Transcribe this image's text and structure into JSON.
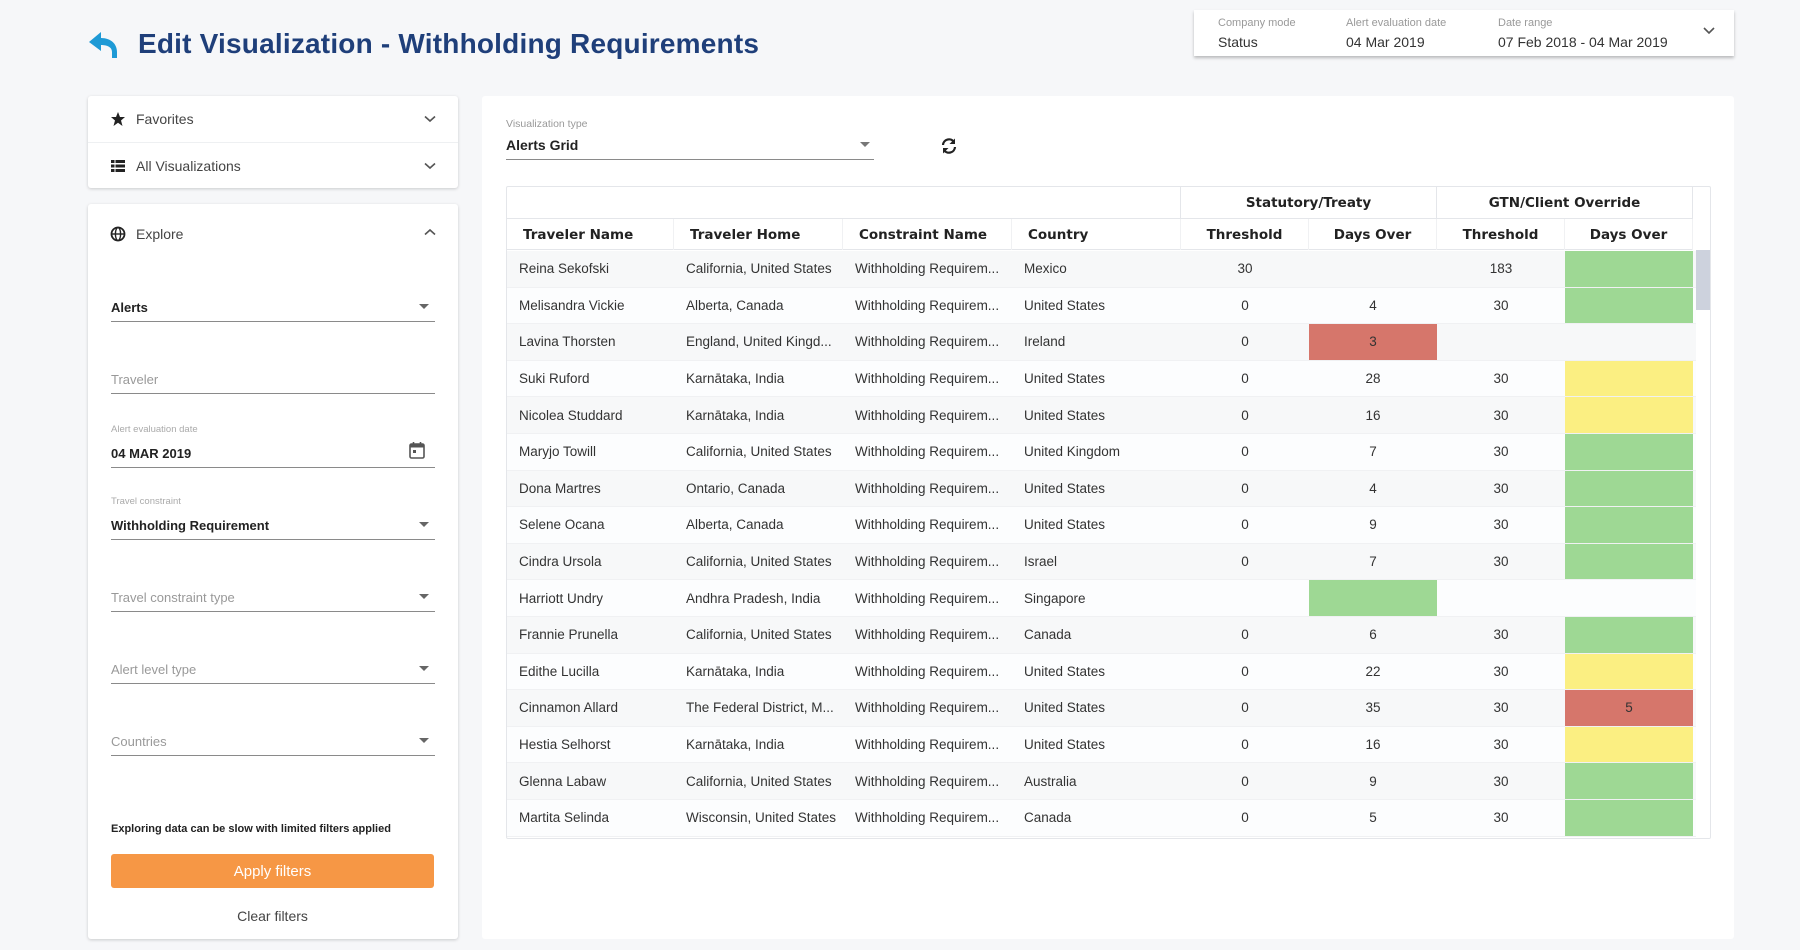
{
  "header": {
    "title": "Edit Visualization - Withholding Requirements",
    "back_icon": "reply-arrow-icon",
    "accent_color": "#1f3f7a"
  },
  "context_bar": {
    "company_mode_label": "Company mode",
    "company_mode_value": "Status",
    "alert_date_label": "Alert evaluation date",
    "alert_date_value": "04 Mar 2019",
    "date_range_label": "Date range",
    "date_range_value": "07 Feb 2018 - 04 Mar 2019"
  },
  "nav": {
    "items": [
      {
        "label": "Favorites",
        "icon": "star-icon"
      },
      {
        "label": "All Visualizations",
        "icon": "list-icon"
      }
    ]
  },
  "explore": {
    "title": "Explore",
    "icon": "globe-icon",
    "fields": {
      "data_source": {
        "value": "Alerts"
      },
      "traveler": {
        "placeholder": "Traveler"
      },
      "alert_date": {
        "label": "Alert evaluation date",
        "value": "04 MAR 2019"
      },
      "travel_constraint": {
        "label": "Travel constraint",
        "value": "Withholding Requirement"
      },
      "travel_constraint_type": {
        "placeholder": "Travel constraint type"
      },
      "alert_level_type": {
        "placeholder": "Alert level type"
      },
      "countries": {
        "placeholder": "Countries"
      }
    },
    "warning": "Exploring data can be slow with limited filters applied",
    "apply_label": "Apply filters",
    "clear_label": "Clear filters",
    "apply_color": "#f69745"
  },
  "main": {
    "vis_type_label": "Visualization type",
    "vis_type_value": "Alerts Grid",
    "refresh_icon": "refresh-icon"
  },
  "grid": {
    "groups": {
      "statutory": "Statutory/Treaty",
      "override": "GTN/Client Override"
    },
    "columns": [
      "Traveler Name",
      "Traveler Home",
      "Constraint Name",
      "Country",
      "Threshold",
      "Days Over",
      "Threshold",
      "Days Over"
    ],
    "status_colors": {
      "green": "#9ed894",
      "yellow": "#fbef82",
      "red": "#d6766b"
    },
    "rows": [
      {
        "name": "Reina Sekofski",
        "home": "California, United States",
        "constraint": "Withholding Requirem...",
        "country": "Mexico",
        "st_threshold": "30",
        "st_days": "",
        "st_status": "",
        "ov_threshold": "183",
        "ov_days": "",
        "ov_status": "green"
      },
      {
        "name": "Melisandra Vickie",
        "home": "Alberta, Canada",
        "constraint": "Withholding Requirem...",
        "country": "United States",
        "st_threshold": "0",
        "st_days": "4",
        "st_status": "",
        "ov_threshold": "30",
        "ov_days": "",
        "ov_status": "green"
      },
      {
        "name": "Lavina Thorsten",
        "home": "England, United Kingd...",
        "constraint": "Withholding Requirem...",
        "country": "Ireland",
        "st_threshold": "0",
        "st_days": "3",
        "st_status": "red",
        "ov_threshold": "",
        "ov_days": "",
        "ov_status": ""
      },
      {
        "name": "Suki Ruford",
        "home": "Karnātaka, India",
        "constraint": "Withholding Requirem...",
        "country": "United States",
        "st_threshold": "0",
        "st_days": "28",
        "st_status": "",
        "ov_threshold": "30",
        "ov_days": "",
        "ov_status": "yellow"
      },
      {
        "name": "Nicolea Studdard",
        "home": "Karnātaka, India",
        "constraint": "Withholding Requirem...",
        "country": "United States",
        "st_threshold": "0",
        "st_days": "16",
        "st_status": "",
        "ov_threshold": "30",
        "ov_days": "",
        "ov_status": "yellow"
      },
      {
        "name": "Maryjo Towill",
        "home": "California, United States",
        "constraint": "Withholding Requirem...",
        "country": "United Kingdom",
        "st_threshold": "0",
        "st_days": "7",
        "st_status": "",
        "ov_threshold": "30",
        "ov_days": "",
        "ov_status": "green"
      },
      {
        "name": "Dona Martres",
        "home": "Ontario, Canada",
        "constraint": "Withholding Requirem...",
        "country": "United States",
        "st_threshold": "0",
        "st_days": "4",
        "st_status": "",
        "ov_threshold": "30",
        "ov_days": "",
        "ov_status": "green"
      },
      {
        "name": "Selene Ocana",
        "home": "Alberta, Canada",
        "constraint": "Withholding Requirem...",
        "country": "United States",
        "st_threshold": "0",
        "st_days": "9",
        "st_status": "",
        "ov_threshold": "30",
        "ov_days": "",
        "ov_status": "green"
      },
      {
        "name": "Cindra Ursola",
        "home": "California, United States",
        "constraint": "Withholding Requirem...",
        "country": "Israel",
        "st_threshold": "0",
        "st_days": "7",
        "st_status": "",
        "ov_threshold": "30",
        "ov_days": "",
        "ov_status": "green"
      },
      {
        "name": "Harriott Undry",
        "home": "Andhra Pradesh, India",
        "constraint": "Withholding Requirem...",
        "country": "Singapore",
        "st_threshold": "",
        "st_days": "",
        "st_status": "green",
        "ov_threshold": "",
        "ov_days": "",
        "ov_status": ""
      },
      {
        "name": "Frannie Prunella",
        "home": "California, United States",
        "constraint": "Withholding Requirem...",
        "country": "Canada",
        "st_threshold": "0",
        "st_days": "6",
        "st_status": "",
        "ov_threshold": "30",
        "ov_days": "",
        "ov_status": "green"
      },
      {
        "name": "Edithe Lucilla",
        "home": "Karnātaka, India",
        "constraint": "Withholding Requirem...",
        "country": "United States",
        "st_threshold": "0",
        "st_days": "22",
        "st_status": "",
        "ov_threshold": "30",
        "ov_days": "",
        "ov_status": "yellow"
      },
      {
        "name": "Cinnamon Allard",
        "home": "The Federal District, M...",
        "constraint": "Withholding Requirem...",
        "country": "United States",
        "st_threshold": "0",
        "st_days": "35",
        "st_status": "",
        "ov_threshold": "30",
        "ov_days": "5",
        "ov_status": "red"
      },
      {
        "name": "Hestia Selhorst",
        "home": "Karnātaka, India",
        "constraint": "Withholding Requirem...",
        "country": "United States",
        "st_threshold": "0",
        "st_days": "16",
        "st_status": "",
        "ov_threshold": "30",
        "ov_days": "",
        "ov_status": "yellow"
      },
      {
        "name": "Glenna Labaw",
        "home": "California, United States",
        "constraint": "Withholding Requirem...",
        "country": "Australia",
        "st_threshold": "0",
        "st_days": "9",
        "st_status": "",
        "ov_threshold": "30",
        "ov_days": "",
        "ov_status": "green"
      },
      {
        "name": "Martita Selinda",
        "home": "Wisconsin, United States",
        "constraint": "Withholding Requirem...",
        "country": "Canada",
        "st_threshold": "0",
        "st_days": "5",
        "st_status": "",
        "ov_threshold": "30",
        "ov_days": "",
        "ov_status": "green"
      }
    ]
  }
}
